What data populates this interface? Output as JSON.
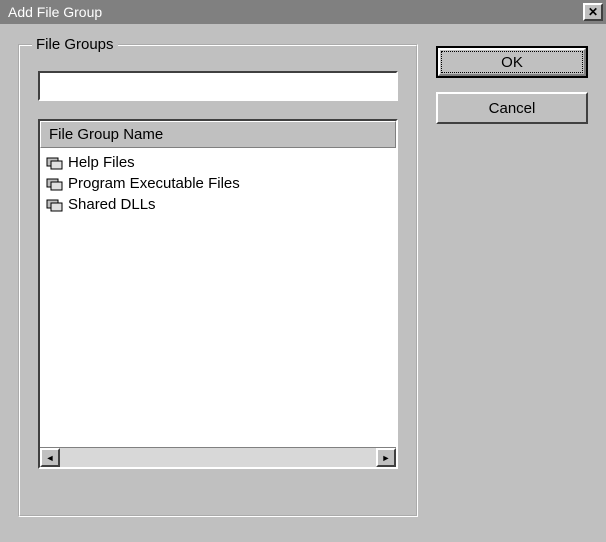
{
  "title": "Add File Group",
  "close_glyph": "✕",
  "groupbox_label": "File Groups",
  "input_value": "",
  "list": {
    "header": "File Group Name",
    "items": [
      "Help Files",
      "Program Executable Files",
      "Shared DLLs"
    ]
  },
  "buttons": {
    "ok": "OK",
    "cancel": "Cancel"
  },
  "scroll": {
    "left": "◄",
    "right": "►"
  }
}
